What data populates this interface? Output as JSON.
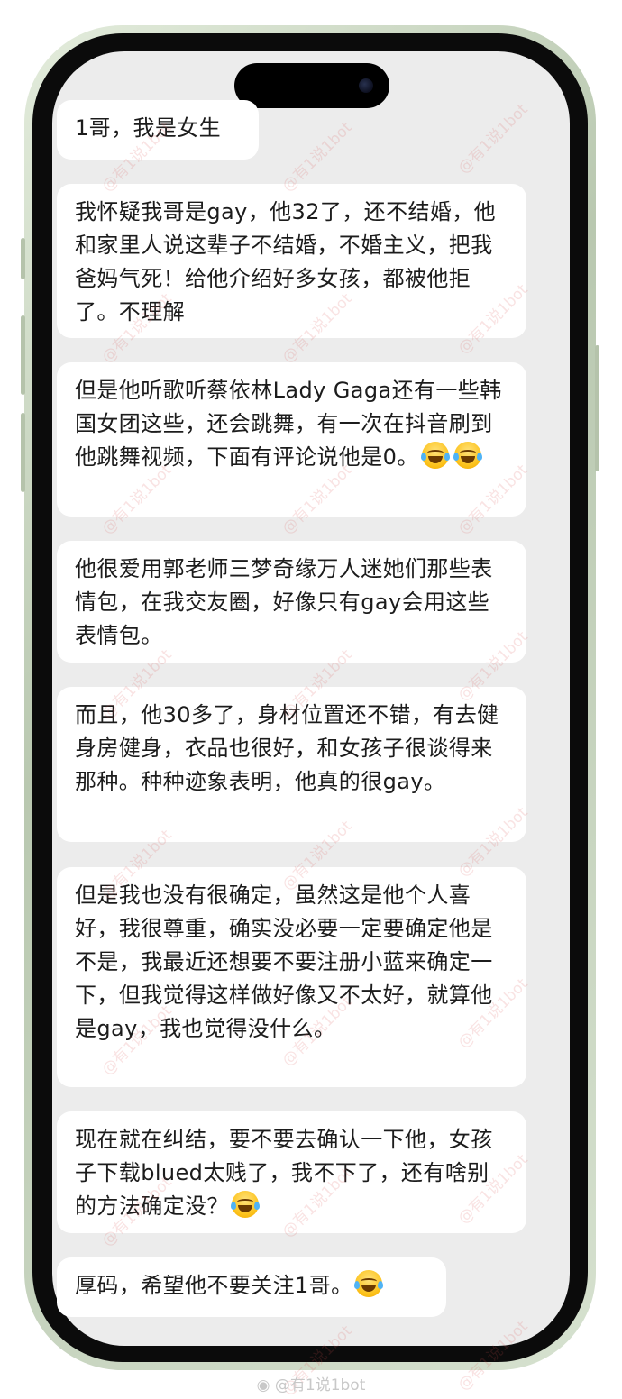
{
  "messages": [
    {
      "text": "1哥，我是女生"
    },
    {
      "text": "我怀疑我哥是gay，他32了，还不结婚，他和家里人说这辈子不结婚，不婚主义，把我爸妈气死！给他介绍好多女孩，都被他拒了。不理解"
    },
    {
      "text": "但是他听歌听蔡依林Lady Gaga还有一些韩国女团这些，还会跳舞，有一次在抖音刷到他跳舞视频，下面有评论说他是0。",
      "emojis": [
        "joy-emoji",
        "joy-emoji"
      ]
    },
    {
      "text": "他很爱用郭老师三梦奇缘万人迷她们那些表情包，在我交友圈，好像只有gay会用这些表情包。"
    },
    {
      "text": "而且，他30多了，身材位置还不错，有去健身房健身，衣品也很好，和女孩子很谈得来那种。种种迹象表明，他真的很gay。"
    },
    {
      "text": "但是我也没有很确定，虽然这是他个人喜好，我很尊重，确实没必要一定要确定他是不是，我最近还想要不要注册小蓝来确定一下，但我觉得这样做好像又不太好，就算他是gay，我也觉得没什么。"
    },
    {
      "text": "现在就在纠结，要不要去确认一下他，女孩子下载blued太贱了，我不下了，还有啥别的方法确定没？",
      "emojis": [
        "joy-emoji"
      ]
    },
    {
      "text": "厚码，希望他不要关注1哥。",
      "emojis": [
        "joy-emoji"
      ]
    }
  ],
  "watermark": {
    "text": "@有1说1bot"
  },
  "footer": {
    "text": "@有1说1bot"
  },
  "colors": {
    "frame": "#c7d4bd",
    "screen": "#ececec",
    "bubble": "#ffffff",
    "text": "#1c1c1c"
  }
}
